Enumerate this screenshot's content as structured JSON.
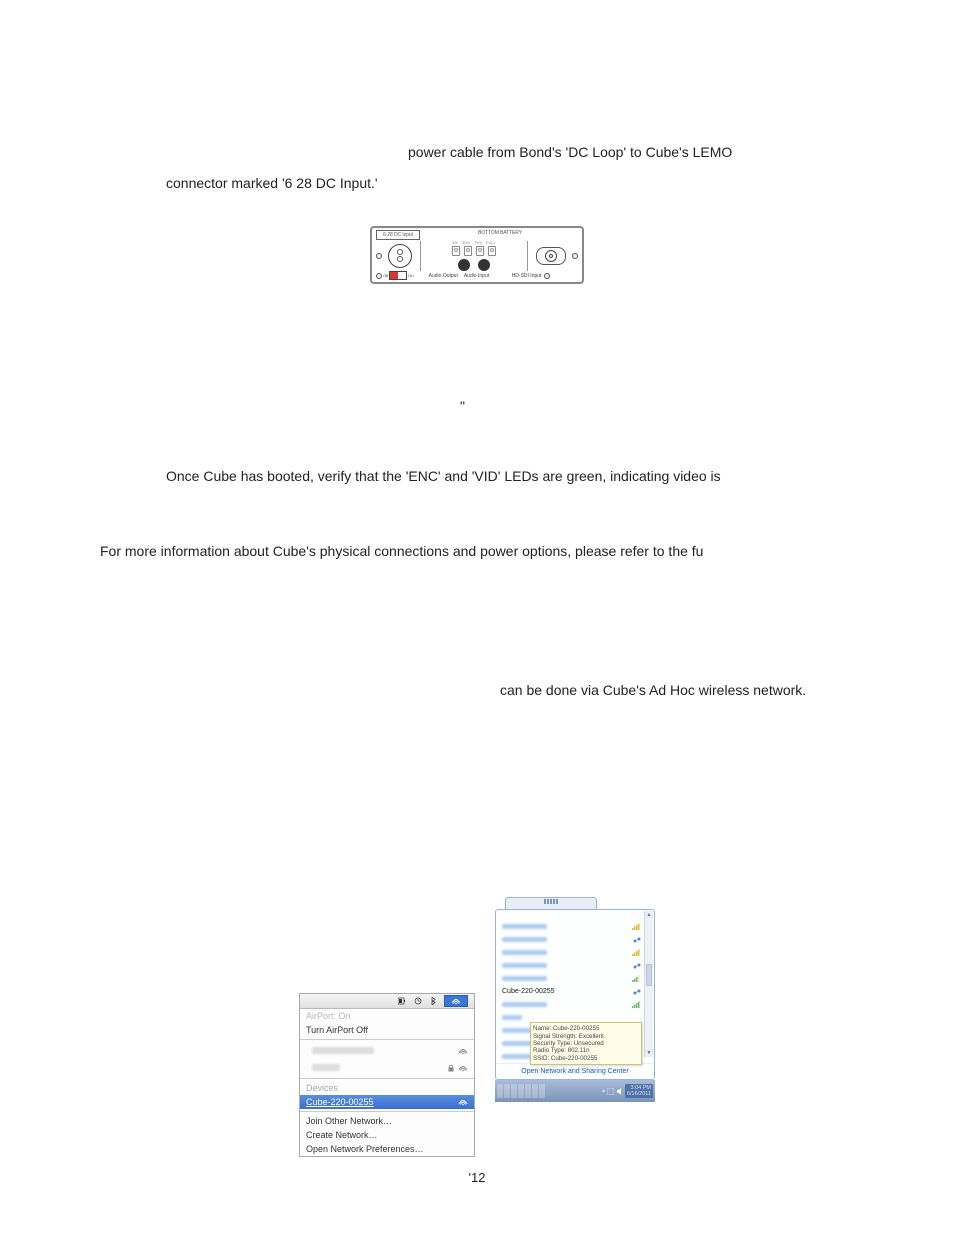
{
  "text": {
    "p1": "power cable from Bond's 'DC Loop' to Cube's LEMO",
    "p2": "connector marked '6 28 DC Input.'",
    "p3": "\"",
    "p4": "Once Cube has booted, verify that the 'ENC' and 'VID' LEDs are green, indicating video is",
    "p5": "For more information about Cube's physical connections and power options, please refer to the fu",
    "p6": "can be done via Cube's Ad Hoc wireless network."
  },
  "device": {
    "dc_input_label": "6-28 DC Input",
    "bottom_battery": "BOTTOM  BATTERY",
    "batt_pct": [
      "5%",
      "50%",
      "75%",
      "FULL"
    ],
    "off": "Off",
    "on": "On",
    "audio_out": "Audio Output",
    "audio_in": "Audio Input",
    "hdsdi": "HD-SDI Input"
  },
  "mac": {
    "airport_on": "AirPort: On",
    "turn_off": "Turn AirPort Off",
    "devices": "Devices",
    "cube": "Cube-220-00255",
    "join_other": "Join Other Network…",
    "create": "Create Network…",
    "open_prefs": "Open Network Preferences…"
  },
  "win": {
    "refresh_icon": "↻",
    "items_blur": [
      "Cube-Stream-Test-2",
      "Customer-09048",
      "AKRT01-secure",
      "Cube-428-09099",
      "Bogart test"
    ],
    "selected": "Cube-220-00255",
    "items_blur2": [
      "Teradek-A-34",
      "bisco",
      "dev-CTI",
      "Cube-428-09099",
      "Cube-428-00228"
    ],
    "tooltip": {
      "l1": "Name: Cube-220-00255",
      "l2": "Signal Strength: Excellent",
      "l3": "Security Type: Unsecured",
      "l4": "Radio Type: 802.11n",
      "l5": "SSID: Cube-220-00255"
    },
    "open_center": "Open Network and Sharing Center",
    "time": "3:04 PM",
    "date": "6/16/2011"
  },
  "page_number": "'12"
}
